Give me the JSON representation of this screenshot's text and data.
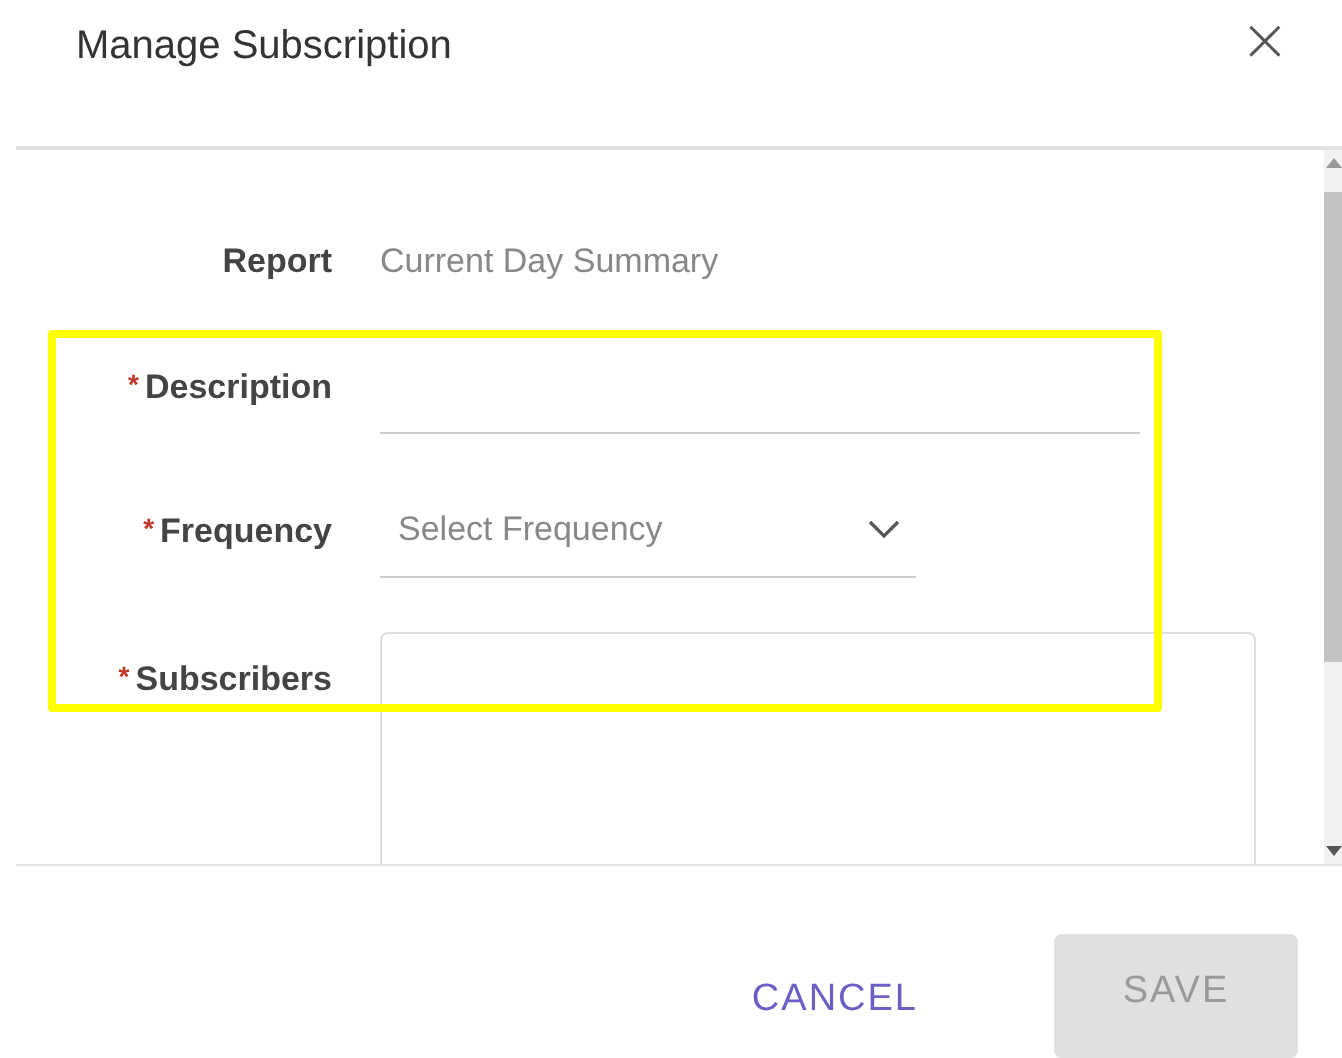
{
  "dialog": {
    "title": "Manage Subscription",
    "close_icon": "×"
  },
  "fields": [
    {
      "kind": "static",
      "label": "Report",
      "value": "Current Day Summary",
      "highlighted": false
    },
    {
      "kind": "input",
      "required_mark": "*",
      "label": "Description",
      "highlighted": true
    },
    {
      "kind": "select",
      "required_mark": "*",
      "label": "Frequency",
      "placeholder": "Select Frequency",
      "highlighted": true
    },
    {
      "kind": "textarea",
      "required_mark": "*",
      "label": "Subscribers",
      "highlighted": true
    }
  ],
  "buttons": [
    {
      "kind": "text",
      "label": "CANCEL",
      "disabled": false
    },
    {
      "kind": "contained",
      "label": "SAVE",
      "disabled": true
    }
  ]
}
